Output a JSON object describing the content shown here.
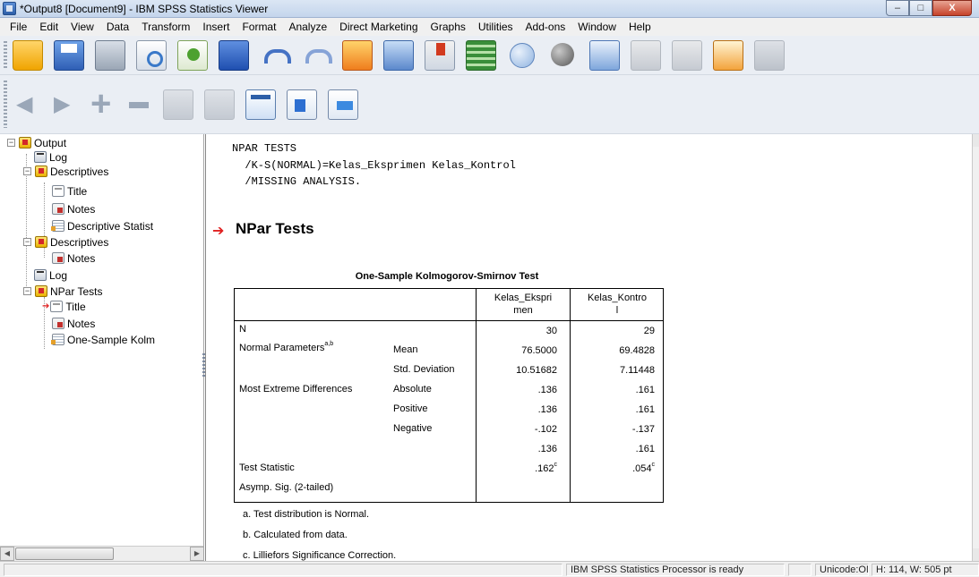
{
  "window": {
    "title": "*Output8 [Document9] - IBM SPSS Statistics Viewer",
    "minimize": "–",
    "maximize": "□",
    "close": "X"
  },
  "menu": [
    {
      "label": "File"
    },
    {
      "label": "Edit"
    },
    {
      "label": "View"
    },
    {
      "label": "Data"
    },
    {
      "label": "Transform"
    },
    {
      "label": "Insert"
    },
    {
      "label": "Format"
    },
    {
      "label": "Analyze"
    },
    {
      "label": "Direct Marketing"
    },
    {
      "label": "Graphs"
    },
    {
      "label": "Utilities"
    },
    {
      "label": "Add-ons"
    },
    {
      "label": "Window"
    },
    {
      "label": "Help"
    }
  ],
  "outline": {
    "items": [
      {
        "label": "Output"
      },
      {
        "label": "Log"
      },
      {
        "label": "Descriptives"
      },
      {
        "label": "Title"
      },
      {
        "label": "Notes"
      },
      {
        "label": "Descriptive Statist"
      },
      {
        "label": "Descriptives"
      },
      {
        "label": "Notes"
      },
      {
        "label": "Log"
      },
      {
        "label": "NPar Tests"
      },
      {
        "label": "Title"
      },
      {
        "label": "Notes"
      },
      {
        "label": "One-Sample Kolm"
      }
    ]
  },
  "syntax": {
    "lines": [
      "NPAR TESTS",
      "  /K-S(NORMAL)=Kelas_Eksprimen Kelas_Kontrol",
      "  /MISSING ANALYSIS."
    ]
  },
  "section": {
    "title": "NPar Tests"
  },
  "ks_table": {
    "title": "One-Sample Kolmogorov-Smirnov Test",
    "col1_line1": "Kelas_Ekspri",
    "col1_line2": "men",
    "col2_line1": "Kelas_Kontro",
    "col2_line2": "l",
    "rows": [
      {
        "label": "N",
        "sub": "",
        "v1": "30",
        "v2": "29"
      },
      {
        "label": "Normal Parameters",
        "label_sup": "a,b",
        "sub": "Mean",
        "v1": "76.5000",
        "v2": "69.4828"
      },
      {
        "label": "",
        "sub": "Std. Deviation",
        "v1": "10.51682",
        "v2": "7.11448"
      },
      {
        "label": "Most Extreme Differences",
        "sub": "Absolute",
        "v1": ".136",
        "v2": ".161"
      },
      {
        "label": "",
        "sub": "Positive",
        "v1": ".136",
        "v2": ".161"
      },
      {
        "label": "",
        "sub": "Negative",
        "v1": "-.102",
        "v2": "-.137"
      },
      {
        "label": "Test Statistic",
        "sub": "",
        "v1": ".136",
        "v2": ".161"
      },
      {
        "label": "Asymp. Sig. (2-tailed)",
        "sub": "",
        "v1": ".162",
        "v1_sup": "c",
        "v2": ".054",
        "v2_sup": "c"
      }
    ],
    "footnotes": [
      "a. Test distribution is Normal.",
      "b. Calculated from data.",
      "c. Lilliefors Significance Correction."
    ]
  },
  "status": {
    "processor": "IBM SPSS Statistics Processor is ready",
    "unicode": "Unicode:ON",
    "size": "H: 114, W: 505 pt"
  },
  "colors": {
    "accent_red": "#e02020",
    "titlebar": "#c4d5ec"
  }
}
